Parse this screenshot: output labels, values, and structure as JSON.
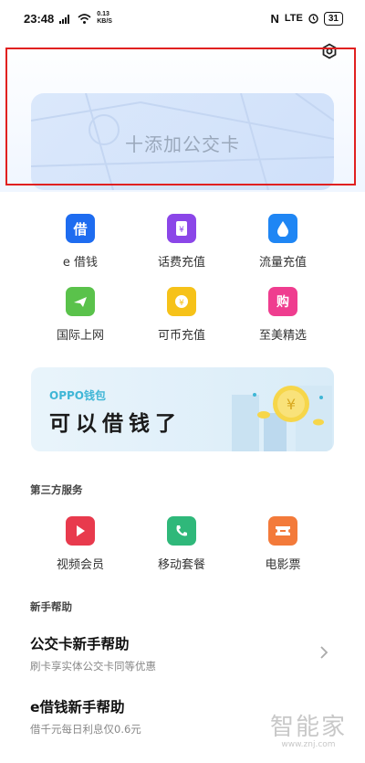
{
  "status_bar": {
    "time": "23:48",
    "network_speed": "0.13 KB/S",
    "signal_label": "LTE",
    "battery": "31"
  },
  "header": {
    "settings_icon": "settings-icon"
  },
  "transit_card": {
    "label": "十添加公交卡"
  },
  "quick_grid": [
    {
      "label": "e 借钱",
      "icon": "e-loan-icon",
      "color": "#1e6cf0"
    },
    {
      "label": "话费充值",
      "icon": "phone-bill-icon",
      "color": "#8b46e8"
    },
    {
      "label": "流量充值",
      "icon": "data-drop-icon",
      "color": "#1f86f4"
    },
    {
      "label": "国际上网",
      "icon": "airplane-icon",
      "color": "#5ac24b"
    },
    {
      "label": "可币充值",
      "icon": "coin-icon",
      "color": "#f6c219"
    },
    {
      "label": "至美精选",
      "icon": "shop-icon",
      "color": "#ef3d8f"
    }
  ],
  "banner": {
    "brand": "OPPO钱包",
    "title": "可以借钱了",
    "accent": "#3fb6d6"
  },
  "third_party": {
    "title": "第三方服务",
    "items": [
      {
        "label": "视频会员",
        "icon": "play-icon",
        "color": "#e83a4d"
      },
      {
        "label": "移动套餐",
        "icon": "phone-handset-icon",
        "color": "#2fb87a"
      },
      {
        "label": "电影票",
        "icon": "ticket-icon",
        "color": "#f37a3a"
      }
    ]
  },
  "help": {
    "title": "新手帮助",
    "items": [
      {
        "title": "公交卡新手帮助",
        "subtitle": "刷卡享实体公交卡同等优惠"
      },
      {
        "title": "e借钱新手帮助",
        "subtitle": "借千元每日利息仅0.6元"
      }
    ]
  },
  "watermark": {
    "text": "智能家",
    "url": "www.znj.com"
  }
}
